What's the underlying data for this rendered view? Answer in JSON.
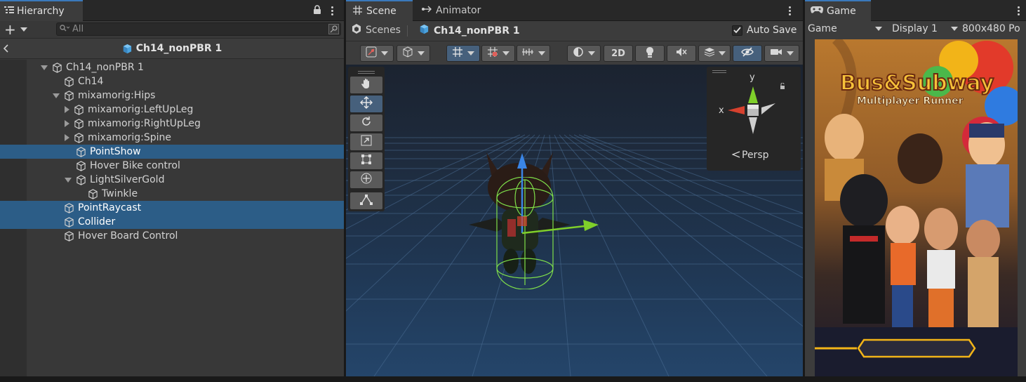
{
  "hierarchy": {
    "tab_label": "Hierarchy",
    "add_label": "+",
    "search_placeholder": "All",
    "breadcrumb": "Ch14_nonPBR 1",
    "items": [
      {
        "label": "Ch14_nonPBR 1",
        "depth": 0,
        "expander": "down",
        "selected": false
      },
      {
        "label": "Ch14",
        "depth": 1,
        "expander": "none",
        "selected": false
      },
      {
        "label": "mixamorig:Hips",
        "depth": 1,
        "expander": "down",
        "selected": false
      },
      {
        "label": "mixamorig:LeftUpLeg",
        "depth": 2,
        "expander": "right",
        "selected": false
      },
      {
        "label": "mixamorig:RightUpLeg",
        "depth": 2,
        "expander": "right",
        "selected": false
      },
      {
        "label": "mixamorig:Spine",
        "depth": 2,
        "expander": "right",
        "selected": false
      },
      {
        "label": "PointShow",
        "depth": 2,
        "expander": "none",
        "selected": true
      },
      {
        "label": "Hover Bike control",
        "depth": 2,
        "expander": "none",
        "selected": false
      },
      {
        "label": "LightSilverGold",
        "depth": 2,
        "expander": "down",
        "selected": false
      },
      {
        "label": "Twinkle",
        "depth": 3,
        "expander": "none",
        "selected": false
      },
      {
        "label": "PointRaycast",
        "depth": 1,
        "expander": "none",
        "selected": true
      },
      {
        "label": "Collider",
        "depth": 1,
        "expander": "none",
        "selected": true
      },
      {
        "label": "Hover Board Control",
        "depth": 1,
        "expander": "none",
        "selected": false
      }
    ]
  },
  "scene": {
    "tab_scene": "Scene",
    "tab_animator": "Animator",
    "breadcrumb_root": "Scenes",
    "breadcrumb_current": "Ch14_nonPBR 1",
    "auto_save_label": "Auto Save",
    "auto_save_checked": true,
    "btn_2d": "2D",
    "gizmo": {
      "y": "y",
      "x": "x",
      "projection": "Persp"
    }
  },
  "game": {
    "tab_label": "Game",
    "mode_select": "Game",
    "display_select": "Display 1",
    "resolution_select": "800x480 Po",
    "artwork": {
      "title_line1": "Bus&Subway",
      "title_line2": "Multiplayer Runner"
    }
  },
  "colors": {
    "selection": "#2c5d87",
    "accent_tab": "#3a79bb",
    "axis_x": "#d6412e",
    "axis_y": "#7fcf2a",
    "axis_z": "#3a85e6"
  }
}
